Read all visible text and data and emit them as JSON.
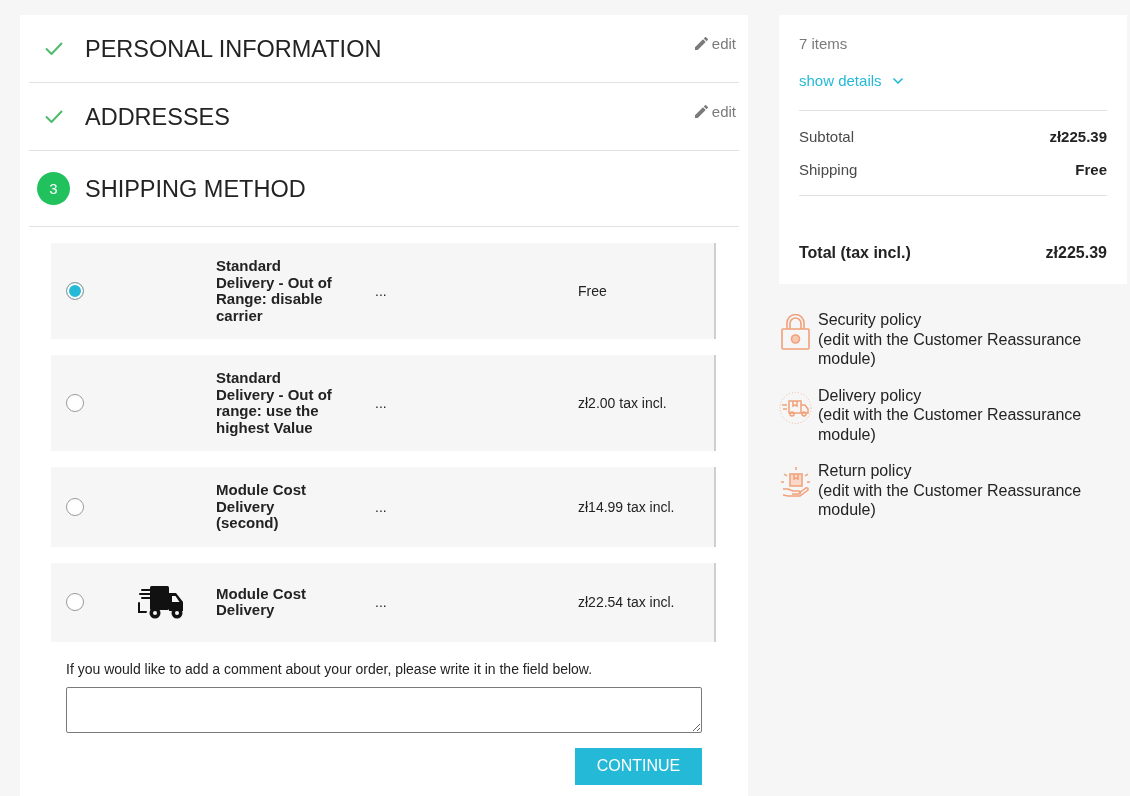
{
  "checkout_steps": [
    {
      "kind": "completed",
      "title": "PERSONAL INFORMATION",
      "edit_link": "edit"
    },
    {
      "kind": "completed",
      "title": "ADDRESSES",
      "edit_link": "edit"
    },
    {
      "kind": "current",
      "number": "3",
      "title": "SHIPPING METHOD"
    }
  ],
  "shipping_options": [
    {
      "selected": true,
      "logo": false,
      "name": "Standard Delivery - Out of Range: disable carrier",
      "delay": "...",
      "price": "Free"
    },
    {
      "selected": false,
      "logo": false,
      "name": "Standard Delivery - Out of range: use the highest Value",
      "delay": "...",
      "price": "zł2.00 tax incl."
    },
    {
      "selected": false,
      "logo": false,
      "name": "Module Cost Delivery (second)",
      "delay": "...",
      "price": "zł14.99 tax incl."
    },
    {
      "selected": false,
      "logo": true,
      "name": "Module Cost Delivery",
      "delay": "...",
      "price": "zł22.54 tax incl."
    }
  ],
  "comment": {
    "label": "If you would like to add a comment about your order, please write it in the field below."
  },
  "continue_button": "CONTINUE",
  "cart_summary": {
    "items_count": "7 items",
    "details_link": "show details",
    "lines": [
      {
        "label": "Subtotal",
        "value": "zł225.39"
      },
      {
        "label": "Shipping",
        "value": "Free"
      }
    ],
    "total": {
      "label": "Total (tax incl.)",
      "value": "zł225.39"
    }
  },
  "reassurance": [
    {
      "kind": "security",
      "title": "Security policy",
      "description": "(edit with the Customer Reassurance module)"
    },
    {
      "kind": "delivery",
      "title": "Delivery policy",
      "description": "(edit with the Customer Reassurance module)"
    },
    {
      "kind": "return",
      "title": "Return policy",
      "description": "(edit with the Customer Reassurance module)"
    }
  ]
}
